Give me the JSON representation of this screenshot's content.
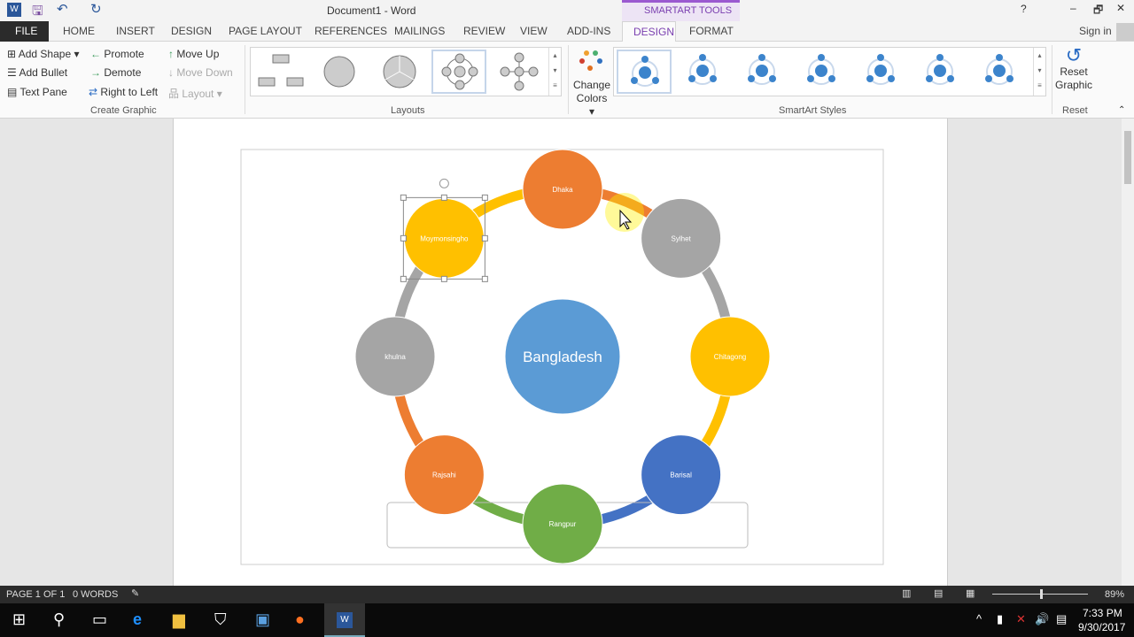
{
  "window": {
    "title": "Document1 - Word",
    "contextual_tab": "SMARTART TOOLS",
    "sign_in": "Sign in",
    "help": "?",
    "minimize": "–",
    "restore": "🗗",
    "close": "✕"
  },
  "tabs": [
    {
      "label": "FILE"
    },
    {
      "label": "HOME"
    },
    {
      "label": "INSERT"
    },
    {
      "label": "DESIGN"
    },
    {
      "label": "PAGE LAYOUT"
    },
    {
      "label": "REFERENCES"
    },
    {
      "label": "MAILINGS"
    },
    {
      "label": "REVIEW"
    },
    {
      "label": "VIEW"
    },
    {
      "label": "ADD-INS"
    },
    {
      "label": "DESIGN"
    },
    {
      "label": "FORMAT"
    }
  ],
  "ribbon": {
    "create_graphic": {
      "add_shape": "Add Shape",
      "add_bullet": "Add Bullet",
      "text_pane": "Text Pane",
      "promote": "Promote",
      "demote": "Demote",
      "right_to_left": "Right to Left",
      "move_up": "Move Up",
      "move_down": "Move Down",
      "layout": "Layout",
      "group": "Create Graphic"
    },
    "layouts": {
      "group": "Layouts"
    },
    "change_colors": "Change Colors",
    "styles": {
      "group": "SmartArt Styles"
    },
    "reset": {
      "button": "Reset Graphic",
      "group": "Reset"
    }
  },
  "smartart": {
    "center": {
      "label": "Bangladesh",
      "color": "#5b9bd5"
    },
    "nodes": [
      {
        "label": "Dhaka",
        "color": "#ed7d31"
      },
      {
        "label": "Sylhet",
        "color": "#a5a5a5"
      },
      {
        "label": "Chitagong",
        "color": "#ffc000"
      },
      {
        "label": "Barisal",
        "color": "#4472c4"
      },
      {
        "label": "Rangpur",
        "color": "#70ad47"
      },
      {
        "label": "Rajsahi",
        "color": "#ed7d31"
      },
      {
        "label": "khulna",
        "color": "#a5a5a5"
      },
      {
        "label": "Moymonsingho",
        "color": "#ffc000"
      }
    ],
    "selected": "Moymonsingho"
  },
  "status": {
    "page": "PAGE 1 OF 1",
    "words": "0 WORDS",
    "zoom": "89%",
    "zoom_level": 89
  },
  "taskbar": {
    "time": "7:33 PM",
    "date": "9/30/2017"
  }
}
